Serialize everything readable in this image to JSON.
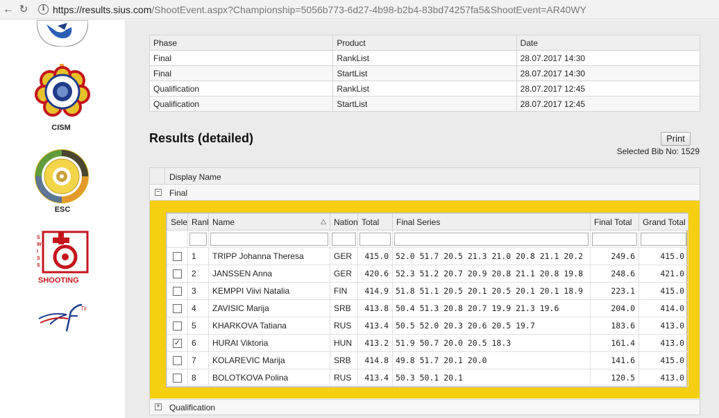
{
  "browser": {
    "url_host": "https://results.sius.com",
    "url_rest": "/ShootEvent.aspx?Championship=5056b773-6d27-4b98-b2b4-83bd74257fa5&ShootEvent=AR40WY"
  },
  "sidebar": {
    "logos": [
      {
        "label": ""
      },
      {
        "label": "CISM"
      },
      {
        "label": "ESC"
      },
      {
        "label": "SHOOTING",
        "brand": "SWISS"
      },
      {
        "label": ""
      }
    ]
  },
  "phases": {
    "headers": [
      "Phase",
      "Product",
      "Date"
    ],
    "rows": [
      [
        "Final",
        "RankList",
        "28.07.2017 14:30"
      ],
      [
        "Final",
        "StartList",
        "28.07.2017 14:30"
      ],
      [
        "Qualification",
        "RankList",
        "28.07.2017 12:45"
      ],
      [
        "Qualification",
        "StartList",
        "28.07.2017 12:45"
      ]
    ]
  },
  "results": {
    "title": "Results (detailed)",
    "print_label": "Print",
    "selected_bib": "Selected Bib No: 1529",
    "display_name_header": "Display Name",
    "groups": {
      "final": "Final",
      "qualification": "Qualification"
    },
    "columns": [
      "Selec",
      "Rank",
      "Name",
      "Nation",
      "Total",
      "Final Series",
      "Final Total",
      "Grand Total"
    ],
    "rows": [
      {
        "checked": false,
        "rank": "1",
        "name": "TRIPP Johanna Theresa",
        "nation": "GER",
        "total": "415.0",
        "series": "52.0 51.7 20.5 21.3 21.0 20.8 21.1 20.2",
        "final_total": "249.6",
        "grand_total": "415.0"
      },
      {
        "checked": false,
        "rank": "2",
        "name": "JANSSEN Anna",
        "nation": "GER",
        "total": "420.6",
        "series": "52.3 51.2 20.7 20.9 20.8 21.1 20.8 19.8",
        "final_total": "248.6",
        "grand_total": "421.0"
      },
      {
        "checked": false,
        "rank": "3",
        "name": "KEMPPI Viivi Natalia",
        "nation": "FIN",
        "total": "414.9",
        "series": "51.8 51.1 20.5 20.1 20.5 20.1 20.1 18.9",
        "final_total": "223.1",
        "grand_total": "415.0"
      },
      {
        "checked": false,
        "rank": "4",
        "name": "ZAVISIC Marija",
        "nation": "SRB",
        "total": "413.8",
        "series": "50.4 51.3 20.8 20.7 19.9 21.3 19.6",
        "final_total": "204.0",
        "grand_total": "414.0"
      },
      {
        "checked": false,
        "rank": "5",
        "name": "KHARKOVA Tatiana",
        "nation": "RUS",
        "total": "413.4",
        "series": "50.5 52.0 20.3 20.6 20.5 19.7",
        "final_total": "183.6",
        "grand_total": "413.0"
      },
      {
        "checked": true,
        "rank": "6",
        "name": "HURAI Viktoria",
        "nation": "HUN",
        "total": "413.2",
        "series": "51.9 50.7 20.0 20.5 18.3",
        "final_total": "161.4",
        "grand_total": "413.0"
      },
      {
        "checked": false,
        "rank": "7",
        "name": "KOLAREVIC Marija",
        "nation": "SRB",
        "total": "414.8",
        "series": "49.8 51.7 20.1 20.0",
        "final_total": "141.6",
        "grand_total": "415.0"
      },
      {
        "checked": false,
        "rank": "8",
        "name": "BOLOTKOVA Polina",
        "nation": "RUS",
        "total": "413.4",
        "series": "50.3 50.1 20.1",
        "final_total": "120.5",
        "grand_total": "413.0"
      }
    ]
  },
  "colors": {
    "final_group_bg": "#f5cf10",
    "page_bg": "#ebebeb"
  }
}
